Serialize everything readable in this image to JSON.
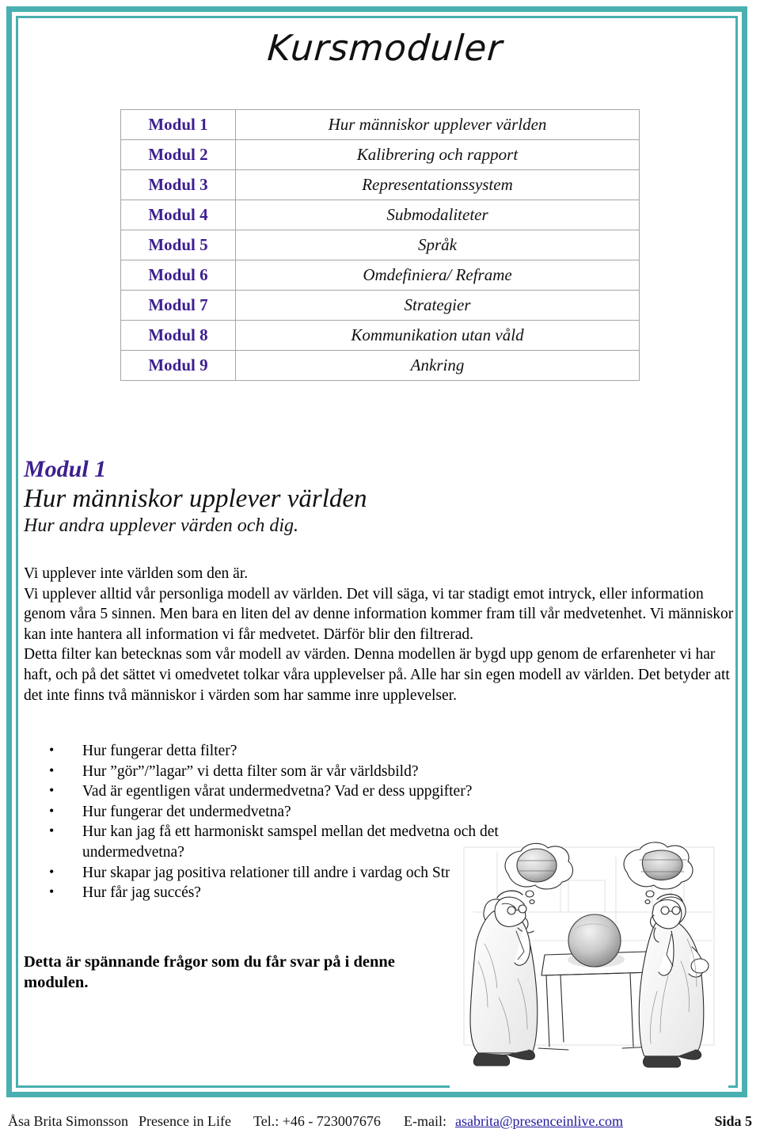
{
  "page": {
    "title": "Kursmoduler",
    "border_color": "#4aafb0",
    "accent_color": "#3d1f8f",
    "link_color": "#21199c"
  },
  "module_table": {
    "rows": [
      {
        "number": "Modul 1",
        "title": "Hur människor upplever världen"
      },
      {
        "number": "Modul 2",
        "title": "Kalibrering och rapport"
      },
      {
        "number": "Modul 3",
        "title": "Representationssystem"
      },
      {
        "number": "Modul 4",
        "title": "Submodaliteter"
      },
      {
        "number": "Modul 5",
        "title": "Språk"
      },
      {
        "number": "Modul 6",
        "title": "Omdefiniera/ Reframe"
      },
      {
        "number": "Modul 7",
        "title": "Strategier"
      },
      {
        "number": "Modul 8",
        "title": "Kommunikation utan våld"
      },
      {
        "number": "Modul 9",
        "title": "Ankring"
      }
    ]
  },
  "module_heading": {
    "kicker": "Modul 1",
    "title": "Hur människor upplever världen",
    "subtitle": "Hur andra upplever värden och dig."
  },
  "body": {
    "lead": "Vi upplever inte världen som den är.",
    "paragraph_1": "Vi upplever alltid vår personliga modell av världen. Det vill säga, vi tar stadigt emot  intryck, eller information genom våra 5 sinnen. Men bara en liten del av denne information kommer fram till vår medvetenhet. Vi människor kan inte hantera all information vi får medvetet. Därför blir den filtrerad.",
    "paragraph_2": "Detta filter kan betecknas som vår modell av värden. Denna modellen är bygd upp genom de erfarenheter vi har haft, och på det sättet vi omedvetet tolkar våra upplevelser på. Alle har sin egen modell av världen. Det betyder att det inte finns två människor i värden som har samme inre upplevelser."
  },
  "questions": [
    "Hur fungerar detta filter?",
    "Hur ”gör”/”lagar” vi detta filter som är vår världsbild?",
    "Vad är egentligen vårat undermedvetna? Vad er dess uppgifter?",
    "Hur fungerar det undermedvetna?",
    "Hur kan jag få ett harmoniskt samspel mellan det medvetna och det undermedvetna?",
    "Hur skapar jag positiva relationer till andre i vardag och Stress?",
    "Hur får jag succés?"
  ],
  "closing_note": "Detta är spännande frågor som du får svar på i denne modulen.",
  "illustration": {
    "caption": "Two men observing a sphere on a table, each with a thought bubble showing a different perception"
  },
  "footer": {
    "name": "Åsa Brita Simonsson",
    "company": "Presence in Life",
    "tel": "Tel.: +46 - 723007676",
    "email_label": "E-mail:",
    "email": "asabrita@presenceinlive.com",
    "page": "Sida 5"
  }
}
